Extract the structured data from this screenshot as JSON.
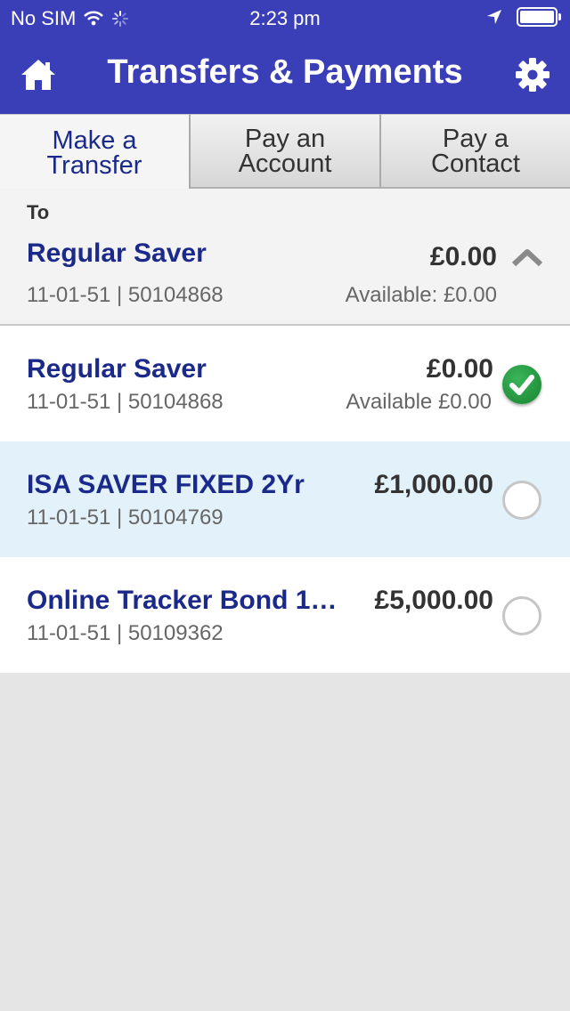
{
  "status_bar": {
    "carrier": "No SIM",
    "time": "2:23 pm"
  },
  "header": {
    "title": "Transfers & Payments",
    "background": "#3a3fb8",
    "icons": {
      "home": "home-icon",
      "settings": "gear-icon"
    }
  },
  "tabs": [
    {
      "label": "Make a Transfer",
      "active": true
    },
    {
      "label": "Pay an Account",
      "active": false
    },
    {
      "label": "Pay a Contact",
      "active": false
    }
  ],
  "to_panel": {
    "label": "To",
    "account_name": "Regular Saver",
    "amount": "£0.00",
    "sort_account": "11-01-51 | 50104868",
    "available": "Available: £0.00"
  },
  "accounts": [
    {
      "name": "Regular Saver",
      "amount": "£0.00",
      "sort_account": "11-01-51 | 50104868",
      "available": "Available £0.00",
      "selected": true
    },
    {
      "name": "ISA SAVER FIXED 2Yr",
      "amount": "£1,000.00",
      "sort_account": "11-01-51 | 50104769",
      "available": "",
      "selected": false
    },
    {
      "name": "Online Tracker Bond 1…",
      "amount": "£5,000.00",
      "sort_account": "11-01-51 | 50109362",
      "available": "",
      "selected": false
    }
  ],
  "colors": {
    "brand_blue": "#3a3fb8",
    "account_name": "#1b2a8a",
    "highlight_row": "#e3f1fa",
    "check_green": "#18842f"
  }
}
